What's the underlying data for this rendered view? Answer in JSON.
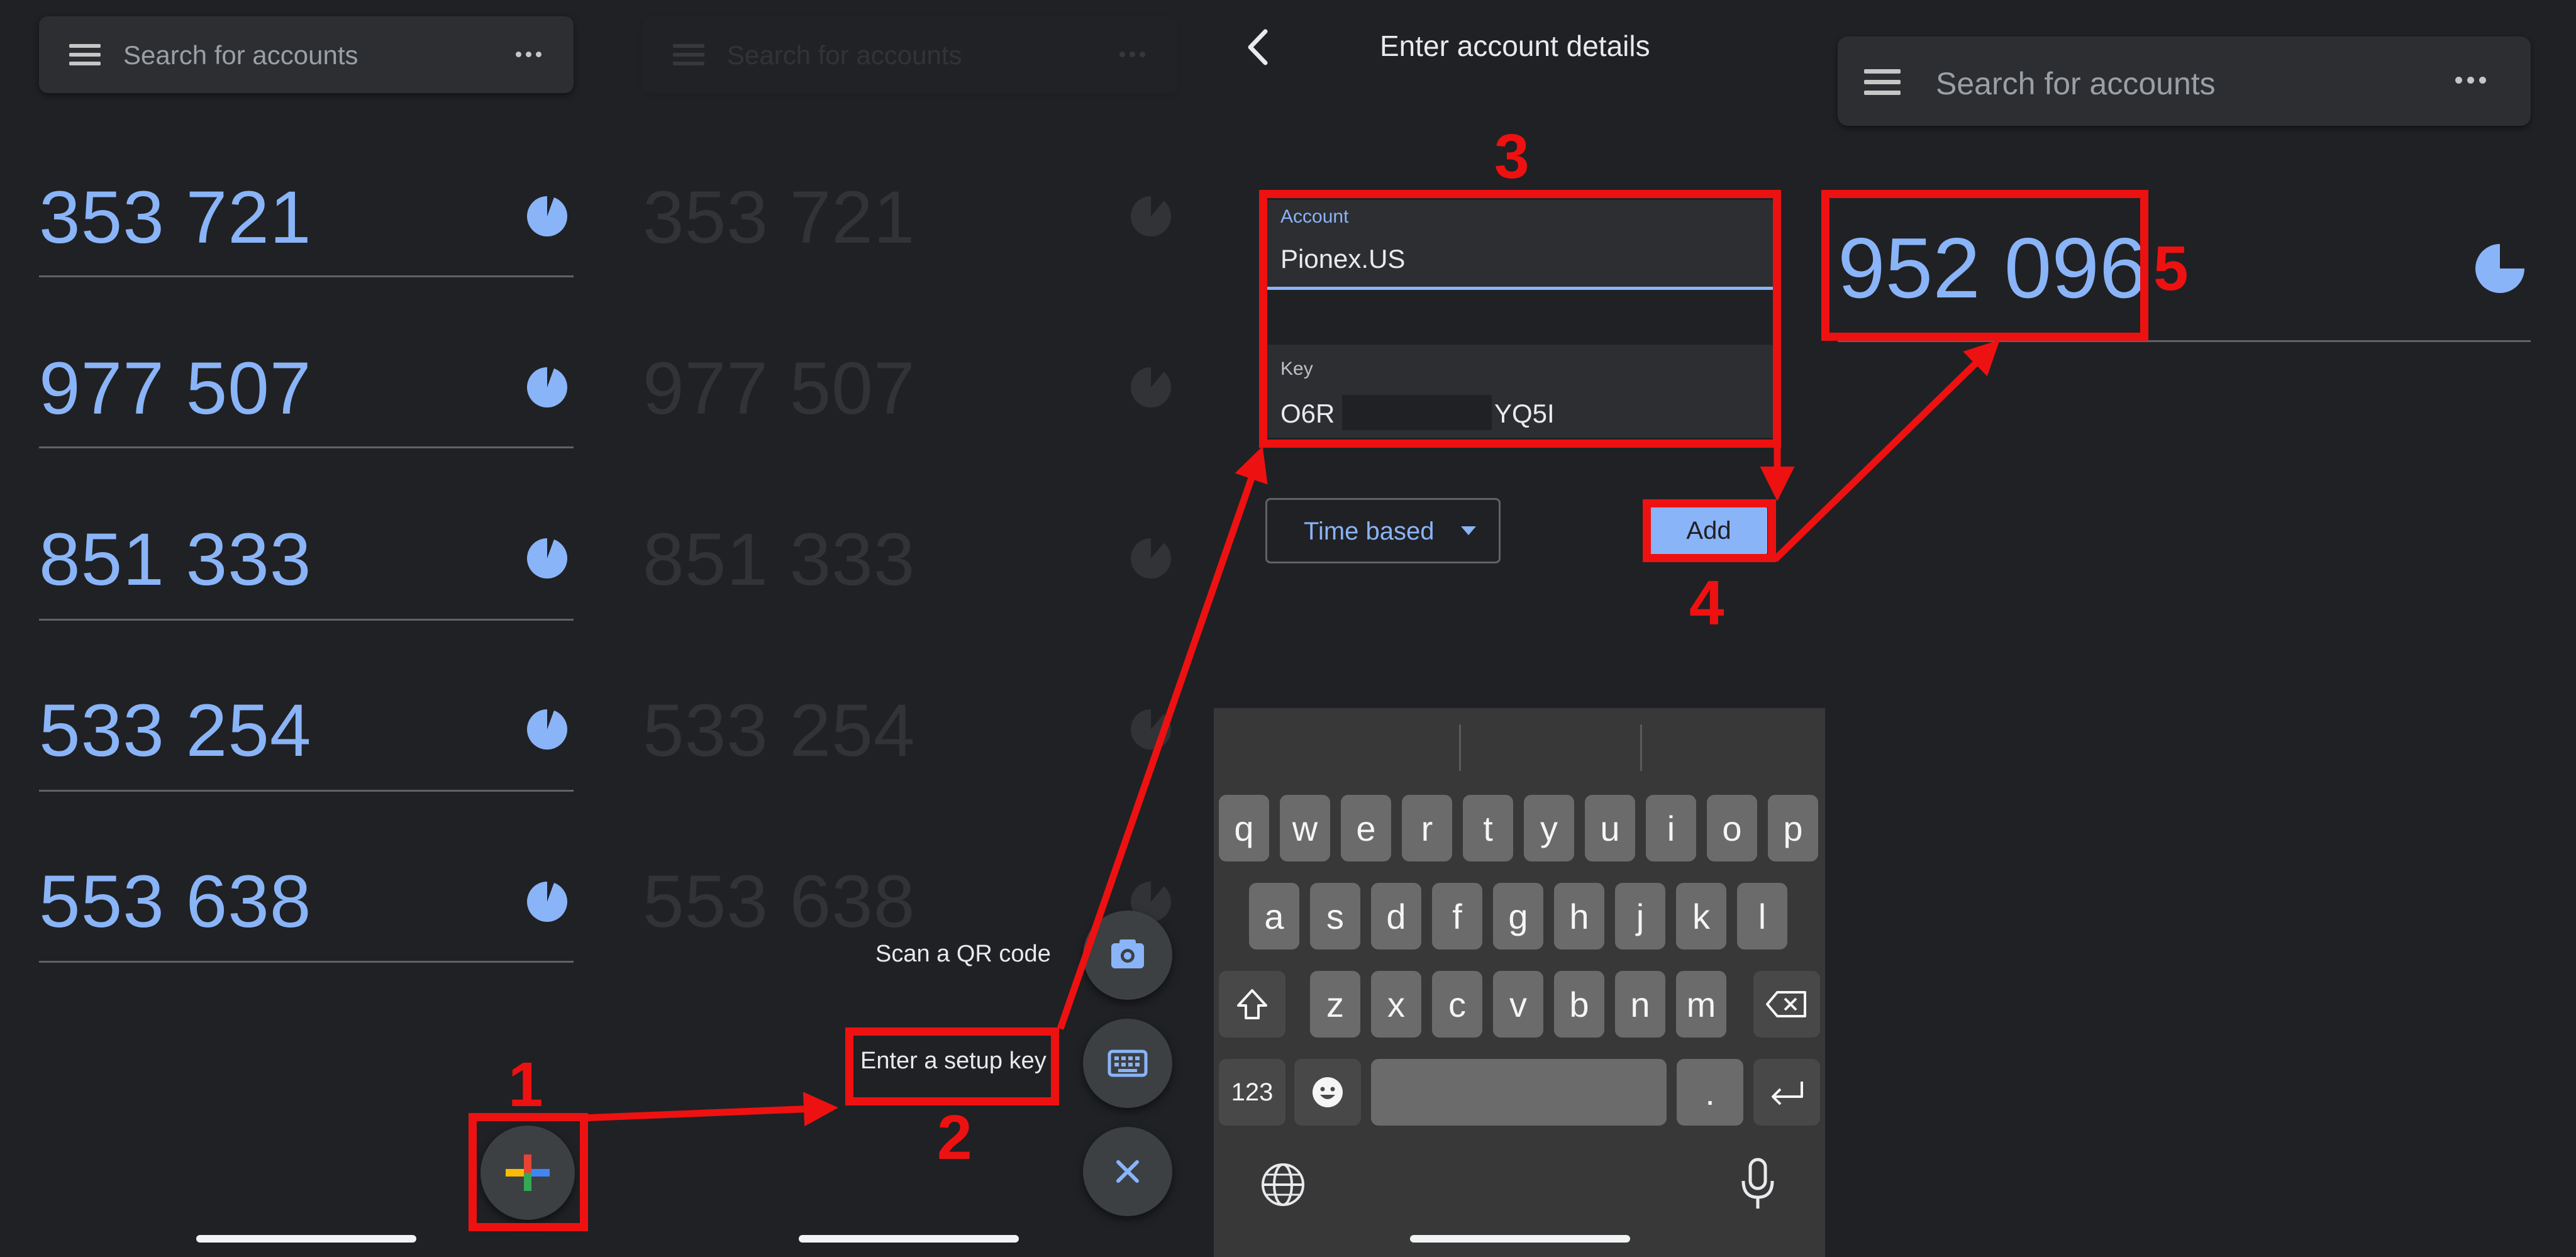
{
  "panel1": {
    "search_placeholder": "Search for accounts",
    "codes": [
      "353 721",
      "977 507",
      "851 333",
      "533 254",
      "553 638"
    ]
  },
  "panel2": {
    "search_placeholder": "Search for accounts",
    "codes": [
      "353 721",
      "977 507",
      "851 333",
      "533 254",
      "553 638"
    ],
    "scan_qr_label": "Scan a QR code",
    "setup_key_label": "Enter a setup key"
  },
  "panel3": {
    "header_title": "Enter account details",
    "account_label": "Account",
    "account_value": "Pionex.US",
    "key_label": "Key",
    "key_prefix": "O6R",
    "key_suffix": "YQ5I",
    "type_select": "Time based",
    "add_button": "Add"
  },
  "keyboard": {
    "row1": [
      "q",
      "w",
      "e",
      "r",
      "t",
      "y",
      "u",
      "i",
      "o",
      "p"
    ],
    "row2": [
      "a",
      "s",
      "d",
      "f",
      "g",
      "h",
      "j",
      "k",
      "l"
    ],
    "row3": [
      "z",
      "x",
      "c",
      "v",
      "b",
      "n",
      "m"
    ],
    "numbers_key": "123",
    "period_key": "."
  },
  "panel4": {
    "search_placeholder": "Search for accounts",
    "code": "952 096"
  },
  "annotations": {
    "step1": "1",
    "step2": "2",
    "step3": "3",
    "step4": "4",
    "step5": "5"
  },
  "colors": {
    "background": "#202124",
    "accent": "#8ab4f8",
    "annotation": "#ee1111"
  }
}
